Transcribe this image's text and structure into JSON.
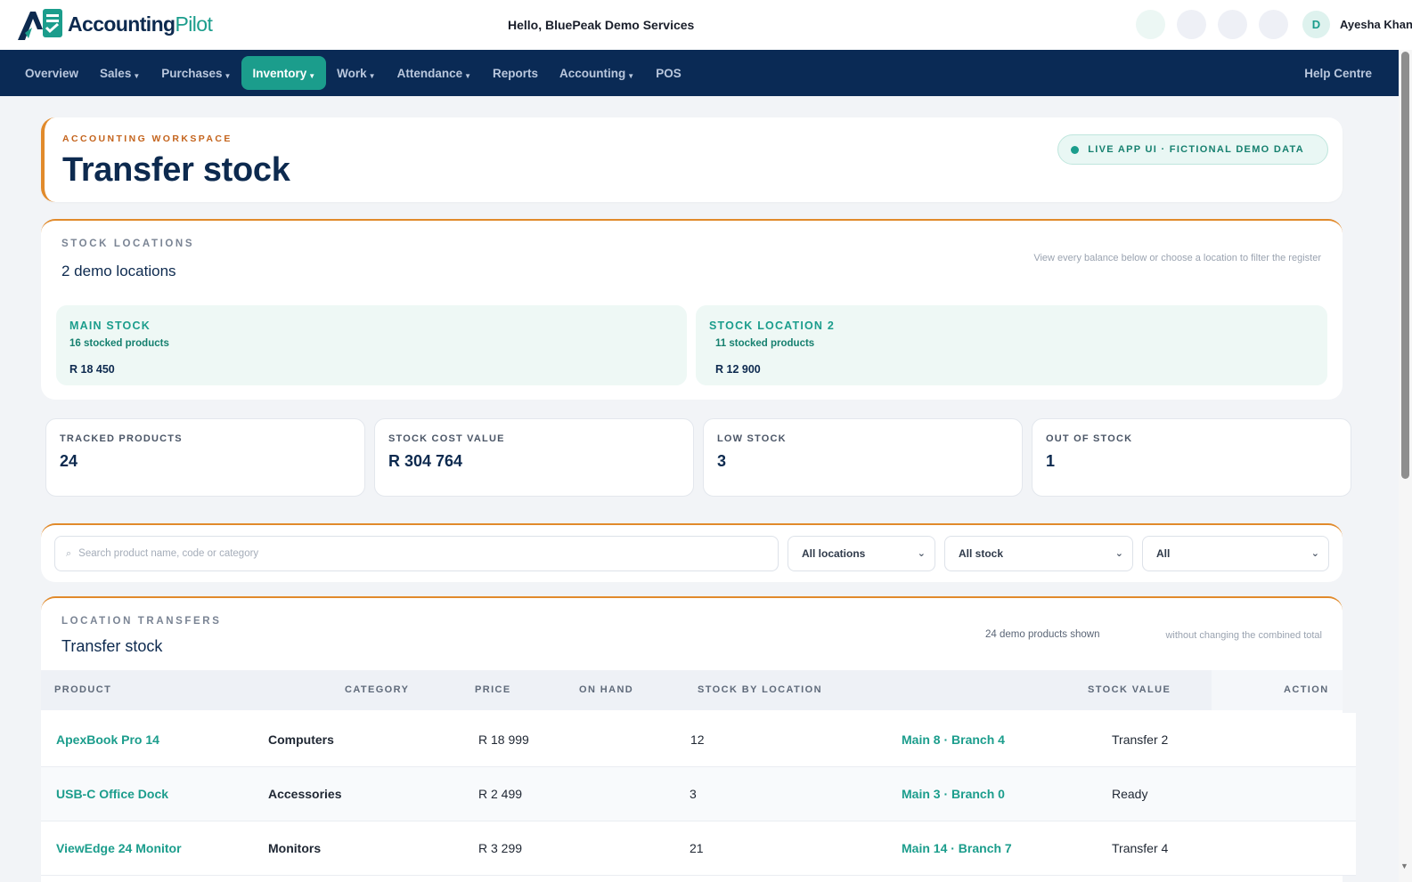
{
  "brand": {
    "name_a": "Accounting",
    "name_b": "Pilot"
  },
  "greeting": "Hello, BluePeak Demo Services",
  "user": {
    "initial": "D",
    "name": "Ayesha Khan"
  },
  "nav": {
    "items": [
      {
        "label": "Overview",
        "dropdown": false
      },
      {
        "label": "Sales",
        "dropdown": true
      },
      {
        "label": "Purchases",
        "dropdown": true
      },
      {
        "label": "Inventory",
        "dropdown": true,
        "active": true
      },
      {
        "label": "Work",
        "dropdown": true
      },
      {
        "label": "Attendance",
        "dropdown": true
      },
      {
        "label": "Reports",
        "dropdown": false
      },
      {
        "label": "Accounting",
        "dropdown": true
      },
      {
        "label": "POS",
        "dropdown": false
      }
    ],
    "help": "Help Centre"
  },
  "header": {
    "eyebrow": "ACCOUNTING WORKSPACE",
    "title": "Transfer stock",
    "badge": "LIVE APP UI · FICTIONAL DEMO DATA"
  },
  "locations": {
    "eyebrow": "STOCK LOCATIONS",
    "count": "2 demo locations",
    "hint": "View every balance below or choose a location to filter the register",
    "tiles": [
      {
        "name": "MAIN STOCK",
        "products": "16 stocked products",
        "value": "R 18 450"
      },
      {
        "name": "STOCK LOCATION 2",
        "products": "11 stocked products",
        "value": "R 12 900"
      }
    ]
  },
  "kpis": [
    {
      "label": "TRACKED PRODUCTS",
      "value": "24"
    },
    {
      "label": "STOCK COST VALUE",
      "value": "R 304 764"
    },
    {
      "label": "LOW STOCK",
      "value": "3"
    },
    {
      "label": "OUT OF STOCK",
      "value": "1"
    }
  ],
  "filters": {
    "search_placeholder": "Search product name, code or category",
    "location": "All locations",
    "stock": "All stock",
    "other": "All"
  },
  "transfers": {
    "eyebrow": "LOCATION TRANSFERS",
    "title": "Transfer stock",
    "shown": "24 demo products shown",
    "note": "without changing the combined total",
    "columns": [
      "PRODUCT",
      "CATEGORY",
      "PRICE",
      "ON HAND",
      "STOCK BY LOCATION",
      "STOCK VALUE",
      "ACTION"
    ],
    "rows": [
      {
        "product": "ApexBook Pro 14",
        "category": "Computers",
        "price": "R 18 999",
        "on_hand": "12",
        "by_location": "Main 8 · Branch 4",
        "status": "Transfer 2"
      },
      {
        "product": "USB-C Office Dock",
        "category": "Accessories",
        "price": "R 2 499",
        "on_hand": "3",
        "by_location": "Main 3 · Branch 0",
        "status": "Ready"
      },
      {
        "product": "ViewEdge 24 Monitor",
        "category": "Monitors",
        "price": "R 3 299",
        "on_hand": "21",
        "by_location": "Main 14 · Branch 7",
        "status": "Transfer 4"
      }
    ]
  }
}
